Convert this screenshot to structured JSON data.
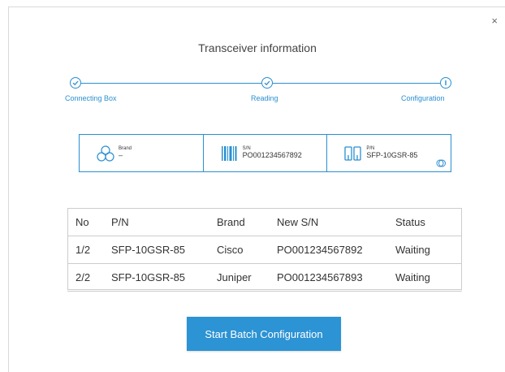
{
  "dialog": {
    "title": "Transceiver information",
    "close_glyph": "×"
  },
  "stepper": {
    "steps": [
      {
        "label": "Connecting Box",
        "state": "done",
        "icon": "check-icon"
      },
      {
        "label": "Reading",
        "state": "done",
        "icon": "check-icon"
      },
      {
        "label": "Configuration",
        "state": "current",
        "icon": "info-icon"
      }
    ]
  },
  "info": {
    "brand": {
      "label": "Brand",
      "value": "–",
      "icon": "brand-icon"
    },
    "sn": {
      "label": "S/N",
      "value": "PO001234567892",
      "icon": "barcode-icon"
    },
    "pn": {
      "label": "P/N",
      "value": "SFP-10GSR-85",
      "icon": "transceiver-icon",
      "edit_icon": "edit-icon"
    }
  },
  "table": {
    "headers": [
      "No",
      "P/N",
      "Brand",
      "New S/N",
      "Status"
    ],
    "rows": [
      [
        "1/2",
        "SFP-10GSR-85",
        "Cisco",
        "PO001234567892",
        "Waiting"
      ],
      [
        "2/2",
        "SFP-10GSR-85",
        "Juniper",
        "PO001234567893",
        "Waiting"
      ]
    ]
  },
  "actions": {
    "start_label": "Start Batch Configuration"
  },
  "colors": {
    "accent": "#2a8fd0",
    "button": "#2c93d4"
  }
}
